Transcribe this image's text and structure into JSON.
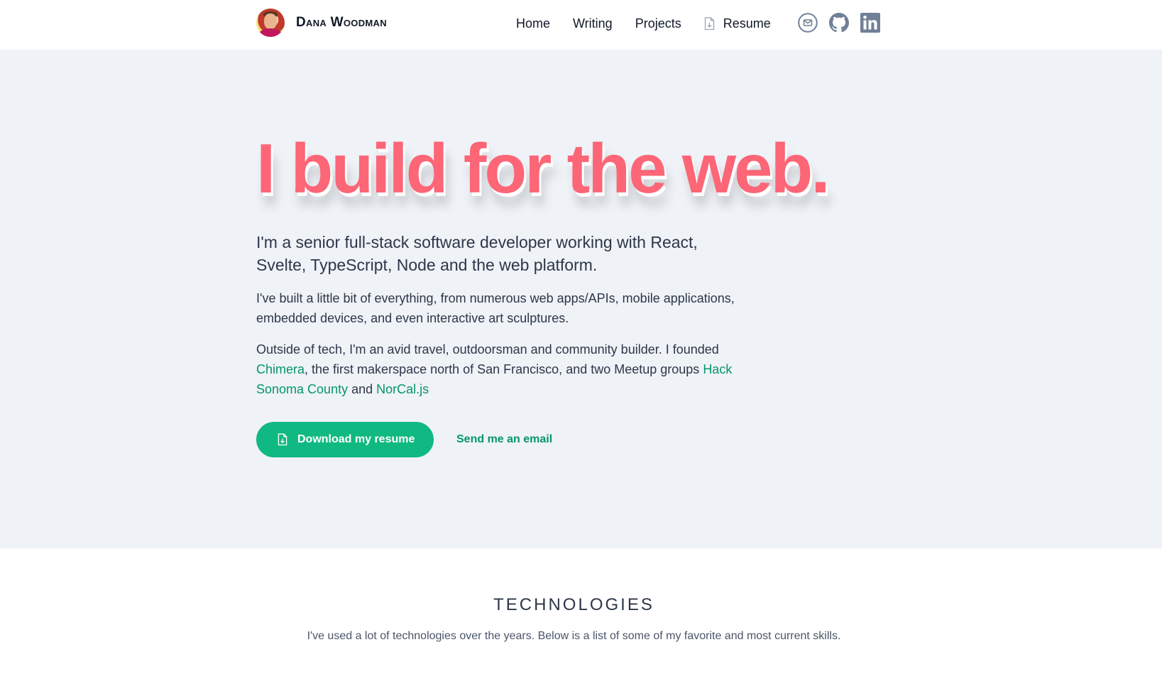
{
  "header": {
    "brand_name": "Dana Woodman",
    "nav": [
      {
        "label": "Home"
      },
      {
        "label": "Writing"
      },
      {
        "label": "Projects"
      },
      {
        "label": "Resume",
        "icon": "document-download-icon"
      }
    ],
    "social": [
      {
        "icon": "email-icon"
      },
      {
        "icon": "github-icon"
      },
      {
        "icon": "linkedin-icon"
      }
    ]
  },
  "hero": {
    "headline": "I build for the web.",
    "lead": "I'm a senior full-stack software developer working with React, Svelte, TypeScript, Node and the web platform.",
    "para1": "I've built a little bit of everything, from numerous web apps/APIs, mobile applications, embedded devices, and even interactive art sculptures.",
    "para2": {
      "intro": "Outside of tech, I'm an avid travel, outdoorsman and community builder. I founded ",
      "link1": "Chimera",
      "mid": ", the first makerspace north of San Francisco, and two Meetup groups ",
      "link2": "Hack Sonoma County",
      "and": " and ",
      "link3": "NorCal.js"
    },
    "primary_button": "Download my resume",
    "secondary_link": "Send me an email"
  },
  "technologies": {
    "title": "TECHNOLOGIES",
    "subtitle": "I've used a lot of technologies over the years. Below is a list of some of my favorite and most current skills."
  },
  "colors": {
    "headline": "#fc6677",
    "accent_green": "#10b981",
    "link_green": "#059669",
    "hero_bg": "#eff2f7",
    "icon_gray": "#718096"
  }
}
